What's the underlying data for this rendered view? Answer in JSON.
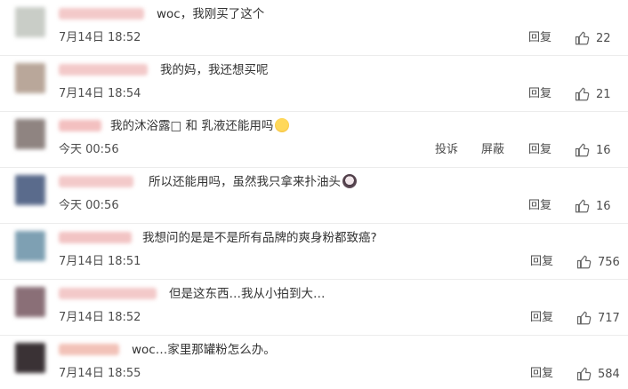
{
  "comments": [
    {
      "text": "woc，我刚买了这个",
      "time": "7月14日 18:52",
      "reply": "回复",
      "likes": "22",
      "avatar_color": "#c9cdc7",
      "username_color": "#f3c9c9"
    },
    {
      "text": "我的妈，我还想买呢",
      "time": "7月14日 18:54",
      "reply": "回复",
      "likes": "21",
      "avatar_color": "#b9a79a",
      "username_color": "#f3c9c9"
    },
    {
      "text": "我的沐浴露□ 和 乳液还能用吗",
      "time": "今天 00:56",
      "report": "投诉",
      "block": "屏蔽",
      "reply": "回复",
      "likes": "16",
      "avatar_color": "#8f8481",
      "username_color": "#f3c0c0",
      "emoji_name": "sweat-smile-emoji"
    },
    {
      "text": "所以还能用吗，虽然我只拿来扑油头",
      "time": "今天 00:56",
      "reply": "回复",
      "likes": "16",
      "avatar_color": "#5a6b8c",
      "username_color": "#f3c9c9",
      "emoji_name": "crying-face-emoji"
    },
    {
      "text": "我想问的是是不是所有品牌的爽身粉都致癌?",
      "time": "7月14日 18:51",
      "reply": "回复",
      "likes": "756",
      "avatar_color": "#7ea0b3",
      "username_color": "#f2c4c4"
    },
    {
      "text": "但是这东西…我从小拍到大…",
      "time": "7月14日 18:52",
      "reply": "回复",
      "likes": "717",
      "avatar_color": "#8a6f77",
      "username_color": "#f3c9c9"
    },
    {
      "text": "woc…家里那罐粉怎么办。",
      "time": "7月14日 18:55",
      "reply": "回复",
      "likes": "584",
      "avatar_color": "#3a3235",
      "username_color": "#f2c2b8"
    }
  ]
}
